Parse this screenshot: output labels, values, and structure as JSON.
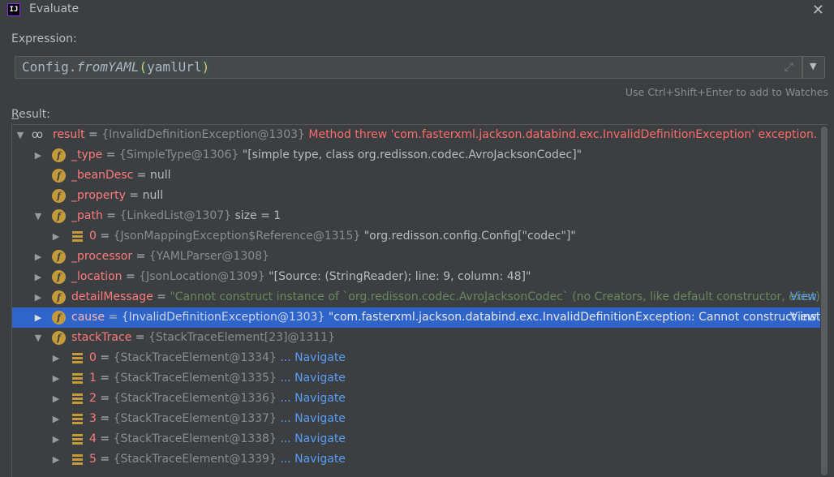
{
  "window": {
    "title": "Evaluate",
    "close_icon": "close-icon",
    "app_icon": "intellij-icon"
  },
  "expression": {
    "label": "Expression:",
    "code_class": "Config.",
    "code_method": "fromYAML",
    "code_open": "(",
    "code_arg": "yamlUrl",
    "code_close": ")",
    "expand_icon": "expand-icon",
    "dropdown_icon": "chevron-down-icon"
  },
  "hint": "Use Ctrl+Shift+Enter to add to Watches",
  "result_label_first": "R",
  "result_label_rest": "esult:",
  "tree": [
    {
      "name": "result",
      "eq": " = ",
      "ref": "{InvalidDefinitionException@1303}",
      "value": " Method threw 'com.fasterxml.jackson.databind.exc.InvalidDefinitionException' exception."
    },
    {
      "name": "_type",
      "eq": " = ",
      "ref": "{SimpleType@1306}",
      "value": " \"[simple type, class org.redisson.codec.AvroJacksonCodec]\""
    },
    {
      "name": "_beanDesc",
      "eq": " = ",
      "ref": "",
      "value": "null"
    },
    {
      "name": "_property",
      "eq": " = ",
      "ref": "",
      "value": "null"
    },
    {
      "name": "_path",
      "eq": " = ",
      "ref": "{LinkedList@1307}",
      "value": "  size = 1"
    },
    {
      "name": "0",
      "eq": " = ",
      "ref": "{JsonMappingException$Reference@1315}",
      "value": " \"org.redisson.config.Config[\"codec\"]\""
    },
    {
      "name": "_processor",
      "eq": " = ",
      "ref": "{YAMLParser@1308}",
      "value": ""
    },
    {
      "name": "_location",
      "eq": " = ",
      "ref": "{JsonLocation@1309}",
      "value": " \"[Source: (StringReader); line: 9, column: 48]\""
    },
    {
      "name": "detailMessage",
      "eq": " = ",
      "ref": "",
      "value": "\"Cannot construct instance of `org.redisson.codec.AvroJacksonCodec` (no Creators, like default constructor, exist): car...",
      "view": "View"
    },
    {
      "name": "cause",
      "eq": " = ",
      "ref": "{InvalidDefinitionException@1303}",
      "value": " \"com.fasterxml.jackson.databind.exc.InvalidDefinitionException: Cannot construct instance...",
      "view": "View"
    },
    {
      "name": "stackTrace",
      "eq": " = ",
      "ref": "{StackTraceElement[23]@1311}",
      "value": ""
    },
    {
      "name": "0",
      "eq": " = ",
      "ref": "{StackTraceElement@1334}",
      "value": " ... Navigate"
    },
    {
      "name": "1",
      "eq": " = ",
      "ref": "{StackTraceElement@1335}",
      "value": " ... Navigate"
    },
    {
      "name": "2",
      "eq": " = ",
      "ref": "{StackTraceElement@1336}",
      "value": " ... Navigate"
    },
    {
      "name": "3",
      "eq": " = ",
      "ref": "{StackTraceElement@1337}",
      "value": " ... Navigate"
    },
    {
      "name": "4",
      "eq": " = ",
      "ref": "{StackTraceElement@1338}",
      "value": " ... Navigate"
    },
    {
      "name": "5",
      "eq": " = ",
      "ref": "{StackTraceElement@1339}",
      "value": " ... Navigate"
    }
  ],
  "colors": {
    "background": "#3c3f41",
    "selection": "#2f65ca",
    "field_name": "#ff7a7a",
    "error": "#ff6b68",
    "link": "#589df6",
    "field_icon": "#c49a3a"
  }
}
